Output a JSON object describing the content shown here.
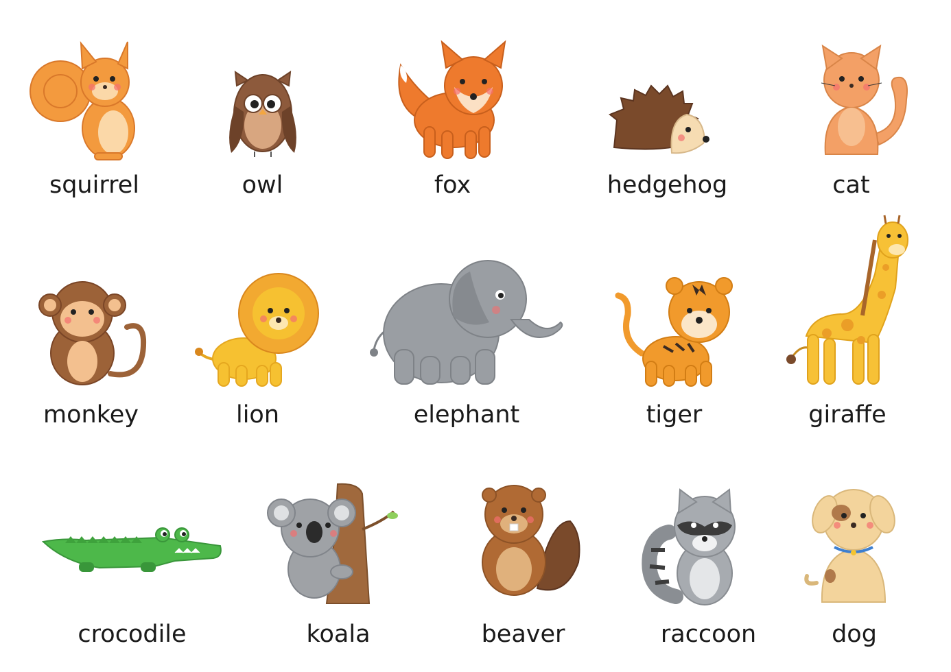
{
  "rows": [
    {
      "animals": [
        {
          "id": "squirrel",
          "label": "squirrel"
        },
        {
          "id": "owl",
          "label": "owl"
        },
        {
          "id": "fox",
          "label": "fox"
        },
        {
          "id": "hedgehog",
          "label": "hedgehog"
        },
        {
          "id": "cat",
          "label": "cat"
        }
      ]
    },
    {
      "animals": [
        {
          "id": "monkey",
          "label": "monkey"
        },
        {
          "id": "lion",
          "label": "lion"
        },
        {
          "id": "elephant",
          "label": "elephant"
        },
        {
          "id": "tiger",
          "label": "tiger"
        },
        {
          "id": "giraffe",
          "label": "giraffe"
        }
      ]
    },
    {
      "animals": [
        {
          "id": "crocodile",
          "label": "crocodile"
        },
        {
          "id": "koala",
          "label": "koala"
        },
        {
          "id": "beaver",
          "label": "beaver"
        },
        {
          "id": "raccoon",
          "label": "raccoon"
        },
        {
          "id": "dog",
          "label": "dog"
        }
      ]
    }
  ],
  "colors": {
    "background": "#ffffff",
    "label": "#1a1a1a",
    "squirrel": "#f39a3e",
    "owl": "#8d5a3c",
    "fox": "#ee7a2d",
    "hedgehog": "#7a4a2b",
    "cat": "#f3a066",
    "monkey": "#9c6238",
    "lion": "#f6c131",
    "elephant": "#9a9ea3",
    "tiger": "#f19a2c",
    "giraffe": "#f7c136",
    "crocodile": "#4db84a",
    "koala": "#9fa2a6",
    "beaver": "#b06a34",
    "raccoon": "#a7abb0",
    "dog": "#f3d49c"
  }
}
